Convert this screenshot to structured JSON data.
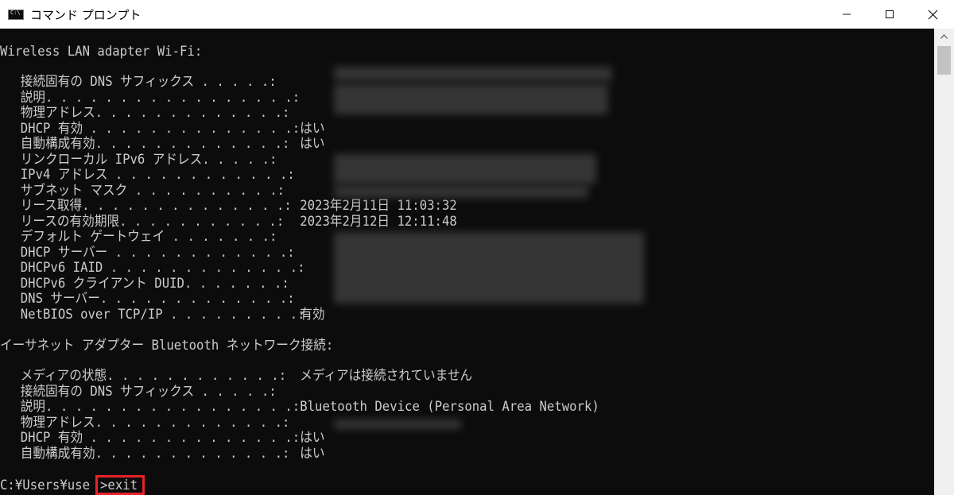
{
  "window": {
    "title": "コマンド プロンプト"
  },
  "console": {
    "wifi_header": "Wireless LAN adapter Wi-Fi:",
    "wifi_rows": [
      {
        "key": "接続固有の DNS サフィックス . . . . .:",
        "value": ""
      },
      {
        "key": "説明. . . . . . . . . . . . . . . . .:",
        "value": ""
      },
      {
        "key": "物理アドレス. . . . . . . . . . . . .:",
        "value": ""
      },
      {
        "key": "DHCP 有効 . . . . . . . . . . . . . .:",
        "value": "はい"
      },
      {
        "key": "自動構成有効. . . . . . . . . . . . .:",
        "value": "はい"
      },
      {
        "key": "リンクローカル IPv6 アドレス. . . . .:",
        "value": ""
      },
      {
        "key": "IPv4 アドレス . . . . . . . . . . . .:",
        "value": ""
      },
      {
        "key": "サブネット マスク . . . . . . . . . .:",
        "value": ""
      },
      {
        "key": "リース取得. . . . . . . . . . . . . .:",
        "value": "2023年2月11日 11:03:32"
      },
      {
        "key": "リースの有効期限. . . . . . . . . . .:",
        "value": "2023年2月12日 12:11:48"
      },
      {
        "key": "デフォルト ゲートウェイ . . . . . . .:",
        "value": ""
      },
      {
        "key": "DHCP サーバー . . . . . . . . . . . .:",
        "value": ""
      },
      {
        "key": "DHCPv6 IAID . . . . . . . . . . . . .:",
        "value": ""
      },
      {
        "key": "DHCPv6 クライアント DUID. . . . . . .:",
        "value": ""
      },
      {
        "key": "DNS サーバー. . . . . . . . . . . . .:",
        "value": ""
      },
      {
        "key": "NetBIOS over TCP/IP . . . . . . . . .:",
        "value": "有効"
      }
    ],
    "bt_header": "イーサネット アダプター Bluetooth ネットワーク接続:",
    "bt_rows": [
      {
        "key": "メディアの状態. . . . . . . . . . . .:",
        "value": "メディアは接続されていません"
      },
      {
        "key": "接続固有の DNS サフィックス . . . . .:",
        "value": ""
      },
      {
        "key": "説明. . . . . . . . . . . . . . . . .:",
        "value": "Bluetooth Device (Personal Area Network)"
      },
      {
        "key": "物理アドレス. . . . . . . . . . . . .:",
        "value": ""
      },
      {
        "key": "DHCP 有効 . . . . . . . . . . . . . .:",
        "value": "はい"
      },
      {
        "key": "自動構成有効. . . . . . . . . . . . .:",
        "value": "はい"
      }
    ],
    "prompt": "C:¥Users¥use",
    "command": ">exit"
  },
  "colors": {
    "console_bg": "#0c0c0c",
    "console_text": "#cccccc",
    "highlight_border": "#e8222a"
  },
  "icons": {
    "app": "cmd-icon",
    "minimize": "minimize-icon",
    "maximize": "maximize-icon",
    "close": "close-icon",
    "scroll_up": "chevron-up-icon"
  }
}
